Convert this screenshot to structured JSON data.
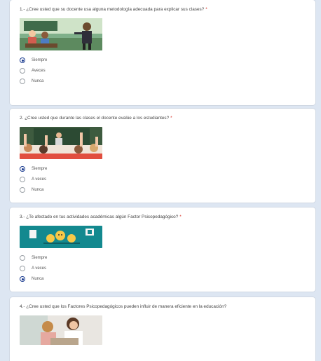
{
  "accent_color": "#1a3b8f",
  "required_mark": "*",
  "questions": [
    {
      "title": "1.- ¿Cree usted que su docente usa alguna metodología adecuada para explicar sus clases?",
      "image_icon": "cartoon-teacher-classroom",
      "options": [
        {
          "label": "Siempre",
          "selected": true
        },
        {
          "label": "Aveces",
          "selected": false
        },
        {
          "label": "Nunca",
          "selected": false
        }
      ]
    },
    {
      "title": "2. ¿Cree usted que durante las clases el docente evalúe a los estudiantes?",
      "image_icon": "students-raising-hands",
      "options": [
        {
          "label": "Siempre",
          "selected": true
        },
        {
          "label": "A veces",
          "selected": false
        },
        {
          "label": "Nunca",
          "selected": false
        }
      ]
    },
    {
      "title": "3.- ¿Te afectado en tus actividades académicas algún Factor Psicopedagógico?",
      "image_icon": "emoji-emotions",
      "options": [
        {
          "label": "Siempre",
          "selected": false
        },
        {
          "label": "A veces",
          "selected": false
        },
        {
          "label": "Nunca",
          "selected": true
        }
      ]
    },
    {
      "title": "4.- ¿Cree usted que los Factores Psicopedagógicos pueden influir de manera eficiente en la educación?",
      "image_icon": "teacher-and-child",
      "options": []
    }
  ]
}
